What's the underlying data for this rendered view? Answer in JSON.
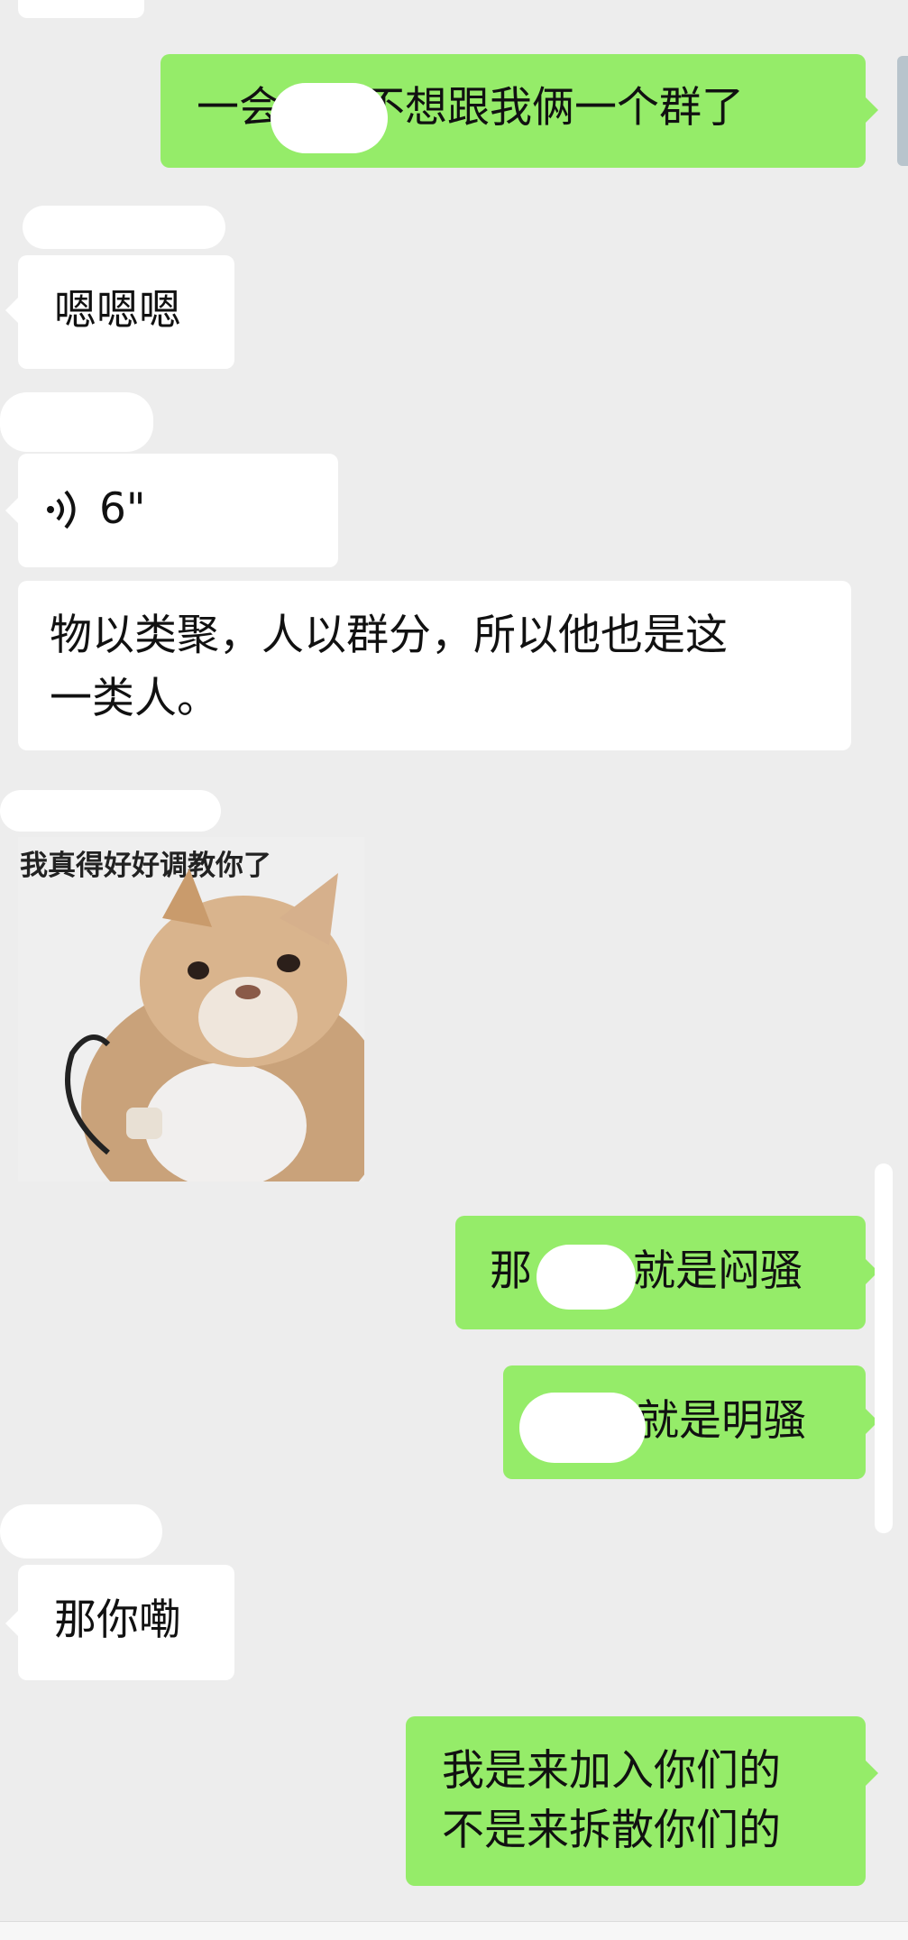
{
  "messages": [
    {
      "id": "m1",
      "side": "out",
      "text_before": "一会",
      "text_after": "不想跟我俩一个群了"
    },
    {
      "id": "m2",
      "side": "in",
      "text": "嗯嗯嗯"
    },
    {
      "id": "m3",
      "side": "in",
      "type": "voice",
      "duration": "6\""
    },
    {
      "id": "m4",
      "side": "in",
      "line1": "物以类聚，人以群分，所以他也是这",
      "line2": "一类人。"
    },
    {
      "id": "m5",
      "side": "in",
      "type": "sticker",
      "caption": "我真得好好调教你了"
    },
    {
      "id": "m6",
      "side": "out",
      "text_before": "那",
      "text_after": "就是闷骚"
    },
    {
      "id": "m7",
      "side": "out",
      "text_after": "就是明骚"
    },
    {
      "id": "m8",
      "side": "in",
      "text": "那你嘞"
    },
    {
      "id": "m9",
      "side": "out",
      "line1": "我是来加入你们的",
      "line2": "不是来拆散你们的"
    }
  ],
  "colors": {
    "background": "#ededed",
    "incoming_bubble": "#ffffff",
    "outgoing_bubble": "#95ec69"
  },
  "icons": {
    "voice": "voice-wave-icon"
  }
}
